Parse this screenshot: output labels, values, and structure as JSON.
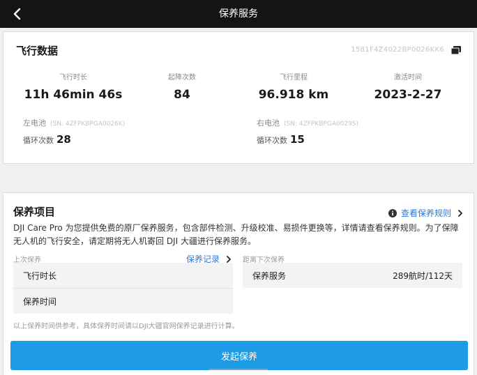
{
  "header": {
    "title": "保养服务",
    "back_icon": "chevron-left-icon"
  },
  "flight_data": {
    "title": "飞行数据",
    "serial": "1581F4Z4022BP0026KK6",
    "stats": [
      {
        "label": "飞行时长",
        "value": "11h 46min 46s"
      },
      {
        "label": "起降次数",
        "value": "84"
      },
      {
        "label": "飞行里程",
        "value": "96.918 km"
      },
      {
        "label": "激活时间",
        "value": "2023-2-27"
      }
    ],
    "batteries": [
      {
        "label": "左电池",
        "sn": "(SN: 4ZFPKBPGA0026K)",
        "cycle_label": "循环次数",
        "cycle_value": "28"
      },
      {
        "label": "右电池",
        "sn": "(SN: 4ZFPKBPGA0029S)",
        "cycle_label": "循环次数",
        "cycle_value": "15"
      }
    ]
  },
  "maintenance": {
    "title": "保养项目",
    "rules_link": "查看保养规则",
    "description": "DJI Care Pro 为您提供免费的原厂保养服务，包含部件检测、升级校准、易损件更换等，详情请查看保养规则。为了保障无人机的飞行安全，请定期将无人机寄回 DJI 大疆进行保养服务。",
    "last_label": "上次保养",
    "record_link": "保养记录",
    "next_label": "距离下次保养",
    "last_rows": [
      "飞行时长",
      "保养时间"
    ],
    "next_row": {
      "label": "保养服务",
      "value": "289航时/112天"
    },
    "footnote": "以上保养时间供参考，具体保养时间请以DJI大疆官网保养记录进行计算。",
    "button": "发起保养"
  },
  "colors": {
    "accent": "#1d9be6",
    "link": "#2b7ad8",
    "topbar": "#141414"
  }
}
